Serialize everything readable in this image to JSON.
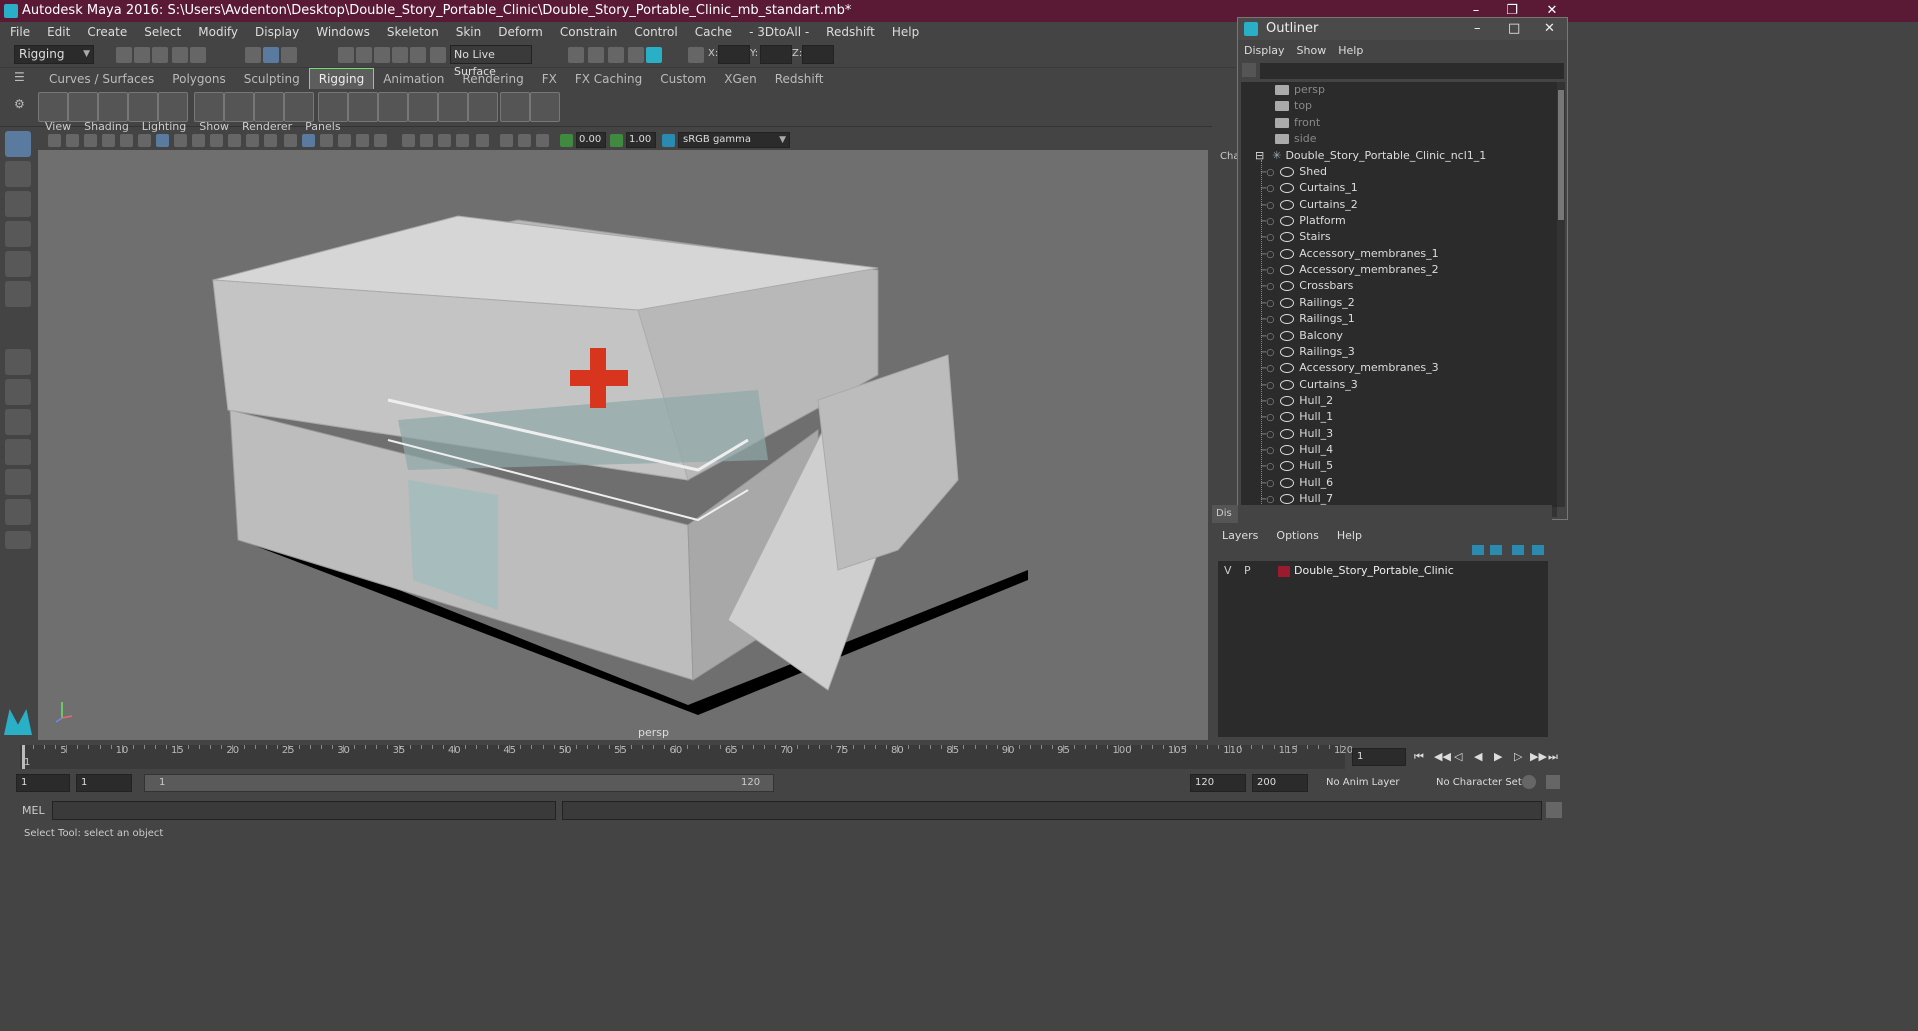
{
  "window": {
    "title": "Autodesk Maya 2016: S:\\Users\\Avdenton\\Desktop\\Double_Story_Portable_Clinic\\Double_Story_Portable_Clinic_mb_standart.mb*"
  },
  "menu": [
    "File",
    "Edit",
    "Create",
    "Select",
    "Modify",
    "Display",
    "Windows",
    "Skeleton",
    "Skin",
    "Deform",
    "Constrain",
    "Control",
    "Cache",
    "- 3DtoAll -",
    "Redshift",
    "Help"
  ],
  "toolbar": {
    "mode": "Rigging",
    "live_surface": "No Live Surface",
    "x_label": "X:",
    "y_label": "Y:",
    "z_label": "Z:"
  },
  "shelf_tabs": [
    {
      "label": "Curves / Surfaces",
      "active": false
    },
    {
      "label": "Polygons",
      "active": false
    },
    {
      "label": "Sculpting",
      "active": false
    },
    {
      "label": "Rigging",
      "active": true
    },
    {
      "label": "Animation",
      "active": false
    },
    {
      "label": "Rendering",
      "active": false
    },
    {
      "label": "FX",
      "active": false
    },
    {
      "label": "FX Caching",
      "active": false
    },
    {
      "label": "Custom",
      "active": false
    },
    {
      "label": "XGen",
      "active": false
    },
    {
      "label": "Redshift",
      "active": false
    }
  ],
  "viewport": {
    "menu": [
      "View",
      "Shading",
      "Lighting",
      "Show",
      "Renderer",
      "Panels"
    ],
    "exposure": "0.00",
    "gamma": "1.00",
    "colorspace": "sRGB gamma",
    "camera_label": "persp"
  },
  "outliner": {
    "title": "Outliner",
    "menu": [
      "Display",
      "Show",
      "Help"
    ],
    "cameras": [
      "persp",
      "top",
      "front",
      "side"
    ],
    "group": "Double_Story_Portable_Clinic_ncl1_1",
    "children": [
      "Shed",
      "Curtains_1",
      "Curtains_2",
      "Platform",
      "Stairs",
      "Accessory_membranes_1",
      "Accessory_membranes_2",
      "Crossbars",
      "Railings_2",
      "Railings_1",
      "Balcony",
      "Railings_3",
      "Accessory_membranes_3",
      "Curtains_3",
      "Hull_2",
      "Hull_1",
      "Hull_3",
      "Hull_4",
      "Hull_5",
      "Hull_6",
      "Hull_7"
    ]
  },
  "channel_box_label": "Cha",
  "display_tab_label": "Dis",
  "layers": {
    "menu": [
      "Layers",
      "Options",
      "Help"
    ],
    "rows": [
      {
        "v": "V",
        "p": "P",
        "color": "#9b1b2e",
        "name": "Double_Story_Portable_Clinic"
      }
    ]
  },
  "timeline": {
    "ticks": [
      "5",
      "10",
      "15",
      "20",
      "25",
      "30",
      "35",
      "40",
      "45",
      "50",
      "55",
      "60",
      "65",
      "70",
      "75",
      "80",
      "85",
      "90",
      "95",
      "100",
      "105",
      "110",
      "115",
      "120"
    ],
    "start_label": "1",
    "current_frame": "1"
  },
  "range": {
    "start": "1",
    "playback_start": "1",
    "range_start_label": "1",
    "range_end_label": "120",
    "playback_end": "120",
    "end": "200",
    "anim_layer": "No Anim Layer",
    "char_set": "No Character Set"
  },
  "cmdline": {
    "label": "MEL"
  },
  "helpline": "Select Tool: select an object"
}
